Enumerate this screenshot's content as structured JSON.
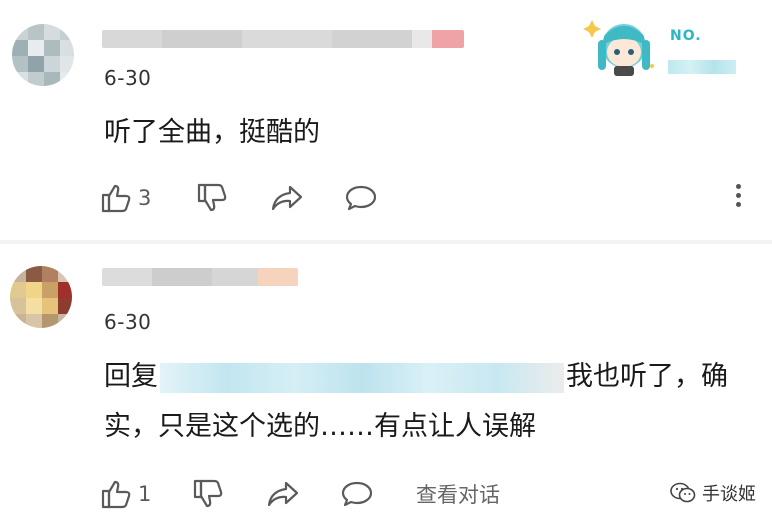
{
  "comments": [
    {
      "date": "6-30",
      "text": "听了全曲，挺酷的",
      "likes": "3",
      "badge": {
        "label": "NO."
      }
    },
    {
      "date": "6-30",
      "reply_prefix": "回复",
      "text_line1_rest": "我也听了，确",
      "text_line2": "实，只是这个选的……有点让人误解",
      "likes": "1",
      "view_conversation": "查看对话"
    }
  ],
  "watermark": "手谈姬",
  "icons": [
    "thumbs-up-icon",
    "thumbs-down-icon",
    "share-icon",
    "comment-icon",
    "more-icon"
  ],
  "colors": {
    "accent": "#2bb6c4",
    "text": "#1a1a1a",
    "muted": "#5a5a5a"
  }
}
